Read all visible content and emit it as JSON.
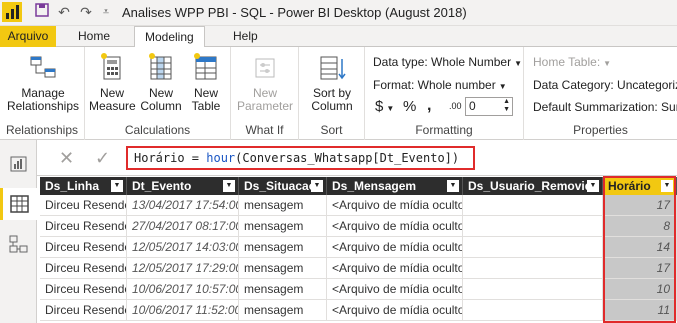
{
  "window": {
    "title": "Analises WPP PBI - SQL - Power BI Desktop (August 2018)"
  },
  "tabs": [
    "Arquivo",
    "Home",
    "Modeling",
    "Help"
  ],
  "ribbon": {
    "relationships": {
      "button": "Manage Relationships",
      "group": "Relationships"
    },
    "calculations": {
      "new_measure": "New Measure",
      "new_column": "New Column",
      "new_table": "New Table",
      "group": "Calculations"
    },
    "whatif": {
      "new_parameter": "New Parameter",
      "group": "What If"
    },
    "sort": {
      "sort_by_column": "Sort by Column",
      "group": "Sort"
    },
    "formatting": {
      "data_type": "Data type: Whole Number",
      "format": "Format: Whole number",
      "currency": "$",
      "percent": "%",
      "thousands": ",",
      "decimals_icon": ".00",
      "decimals_value": "0",
      "group": "Formatting"
    },
    "properties": {
      "home_table": "Home Table:",
      "data_category": "Data Category: Uncategorize",
      "default_summarization": "Default Summarization: Sum",
      "group": "Properties"
    }
  },
  "formula_bar": {
    "lhs": "Horário = ",
    "fn": "hour",
    "args": "(Conversas_Whatsapp[Dt_Evento])"
  },
  "table": {
    "columns": [
      "Ds_Linha",
      "Dt_Evento",
      "Ds_Situacao",
      "Ds_Mensagem",
      "Ds_Usuario_Removido",
      "Horário"
    ],
    "rows": [
      [
        "Dirceu Resende",
        "13/04/2017 17:54:00",
        "mensagem",
        "<Arquivo de mídia oculto>",
        "",
        "17"
      ],
      [
        "Dirceu Resende",
        "27/04/2017 08:17:00",
        "mensagem",
        "<Arquivo de mídia oculto>",
        "",
        "8"
      ],
      [
        "Dirceu Resende",
        "12/05/2017 14:03:00",
        "mensagem",
        "<Arquivo de mídia oculto>",
        "",
        "14"
      ],
      [
        "Dirceu Resende",
        "12/05/2017 17:29:00",
        "mensagem",
        "<Arquivo de mídia oculto>",
        "",
        "17"
      ],
      [
        "Dirceu Resende",
        "10/06/2017 10:57:00",
        "mensagem",
        "<Arquivo de mídia oculto>",
        "",
        "10"
      ],
      [
        "Dirceu Resende",
        "10/06/2017 11:52:00",
        "mensagem",
        "<Arquivo de mídia oculto>",
        "",
        "11"
      ]
    ]
  },
  "colors": {
    "accent": "#f2c811",
    "highlight": "#e02b2b",
    "header": "#2d2d2d",
    "dax_function": "#1a56c4"
  }
}
